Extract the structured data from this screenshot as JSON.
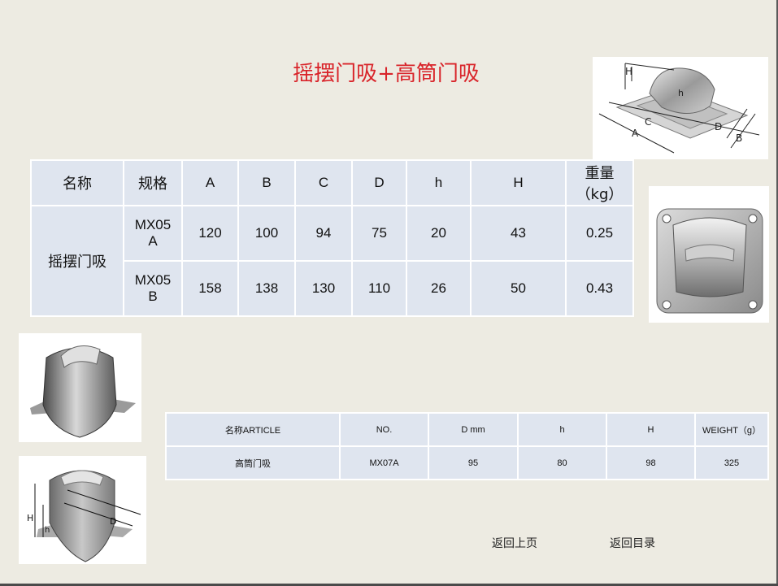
{
  "title": "摇摆门吸+高筒门吸",
  "diagram_labels": {
    "H": "H",
    "h": "h",
    "A": "A",
    "B": "B",
    "C": "C",
    "D": "D"
  },
  "table1": {
    "headers": [
      "名称",
      "规格",
      "A",
      "B",
      "C",
      "D",
      "h",
      "H",
      "重量（kg）"
    ],
    "product_name": "摇摆门吸",
    "rows": [
      {
        "spec_line1": "MX05",
        "spec_line2": "A",
        "A": "120",
        "B": "100",
        "C": "94",
        "D": "75",
        "h": "20",
        "H": "43",
        "weight": "0.25"
      },
      {
        "spec_line1": "MX05",
        "spec_line2": "B",
        "A": "158",
        "B": "138",
        "C": "130",
        "D": "110",
        "h": "26",
        "H": "50",
        "weight": "0.43"
      }
    ]
  },
  "table2": {
    "headers": [
      "名称ARTICLE",
      "NO.",
      "D mm",
      "h",
      "H",
      "WEIGHT（g）"
    ],
    "row": [
      "高筒门吸",
      "MX07A",
      "95",
      "80",
      "98",
      "325"
    ]
  },
  "nav": {
    "prev": "返回上页",
    "catalog": "返回目录"
  }
}
